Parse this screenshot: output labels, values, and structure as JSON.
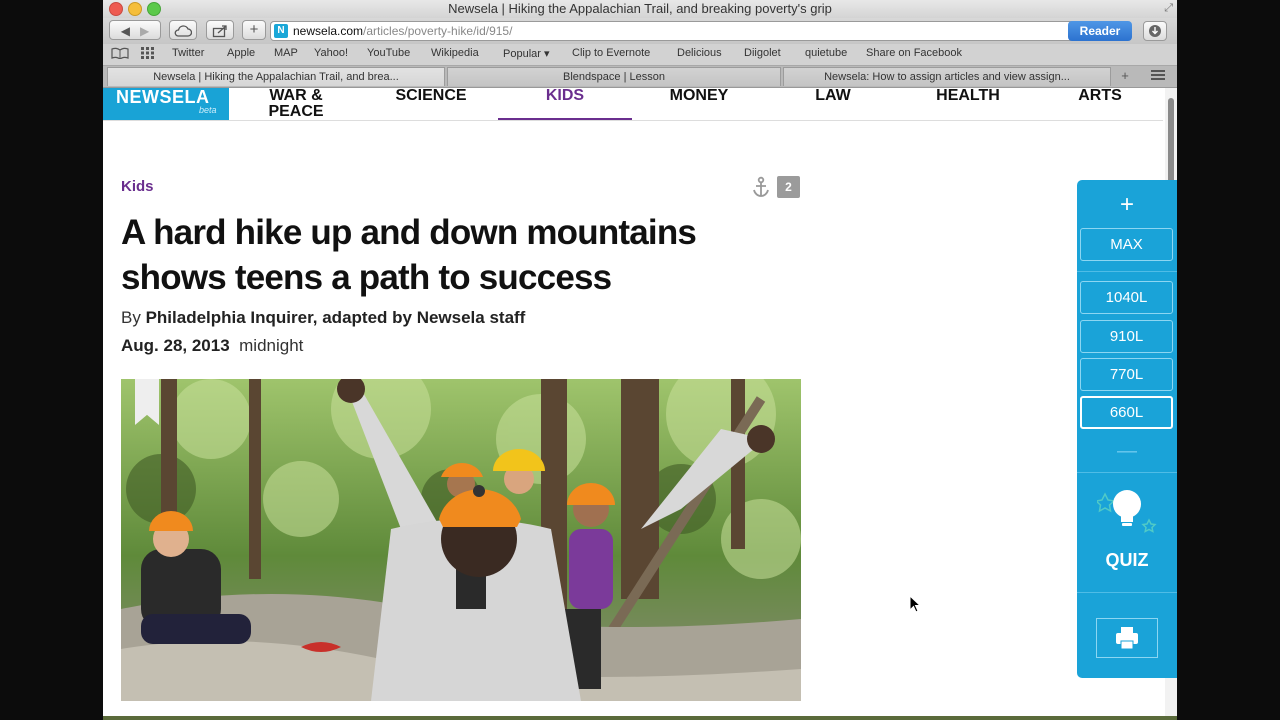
{
  "window": {
    "title": "Newsela | Hiking the Appalachian Trail, and breaking poverty's grip"
  },
  "toolbar": {
    "url_domain": "newsela.com",
    "url_path": "/articles/poverty-hike/id/915/",
    "favicon_letter": "N",
    "reader_label": "Reader"
  },
  "bookmarks": [
    "Twitter",
    "Apple",
    "MAP",
    "Yahoo!",
    "YouTube",
    "Wikipedia",
    "Popular ▾",
    "Clip to Evernote",
    "Delicious",
    "Diigolet",
    "quietube",
    "Share on Facebook"
  ],
  "tabs": [
    "Newsela | Hiking the Appalachian Trail, and brea...",
    "Blendspace | Lesson",
    "Newsela: How to assign articles and view assign..."
  ],
  "site": {
    "logo": "NEWSELA",
    "logo_sub": "beta",
    "nav": [
      "WAR & PEACE",
      "SCIENCE",
      "KIDS",
      "MONEY",
      "LAW",
      "HEALTH",
      "ARTS"
    ]
  },
  "article": {
    "category": "Kids",
    "annotation_count": "2",
    "headline_line1": "A hard hike up and down mountains",
    "headline_line2": "shows teens a path to success",
    "by_prefix": "By",
    "author": "Philadelphia Inquirer, adapted by Newsela staff",
    "date": "Aug. 28, 2013",
    "time": "midnight"
  },
  "levels": {
    "plus": "+",
    "max": "MAX",
    "items": [
      "1040L",
      "910L",
      "770L",
      "660L"
    ],
    "minus": "—",
    "quiz": "QUIZ"
  },
  "colors": {
    "brand_blue": "#1aa3d8",
    "kids_purple": "#6a2e8e",
    "reader_blue": "#2c72cf"
  }
}
